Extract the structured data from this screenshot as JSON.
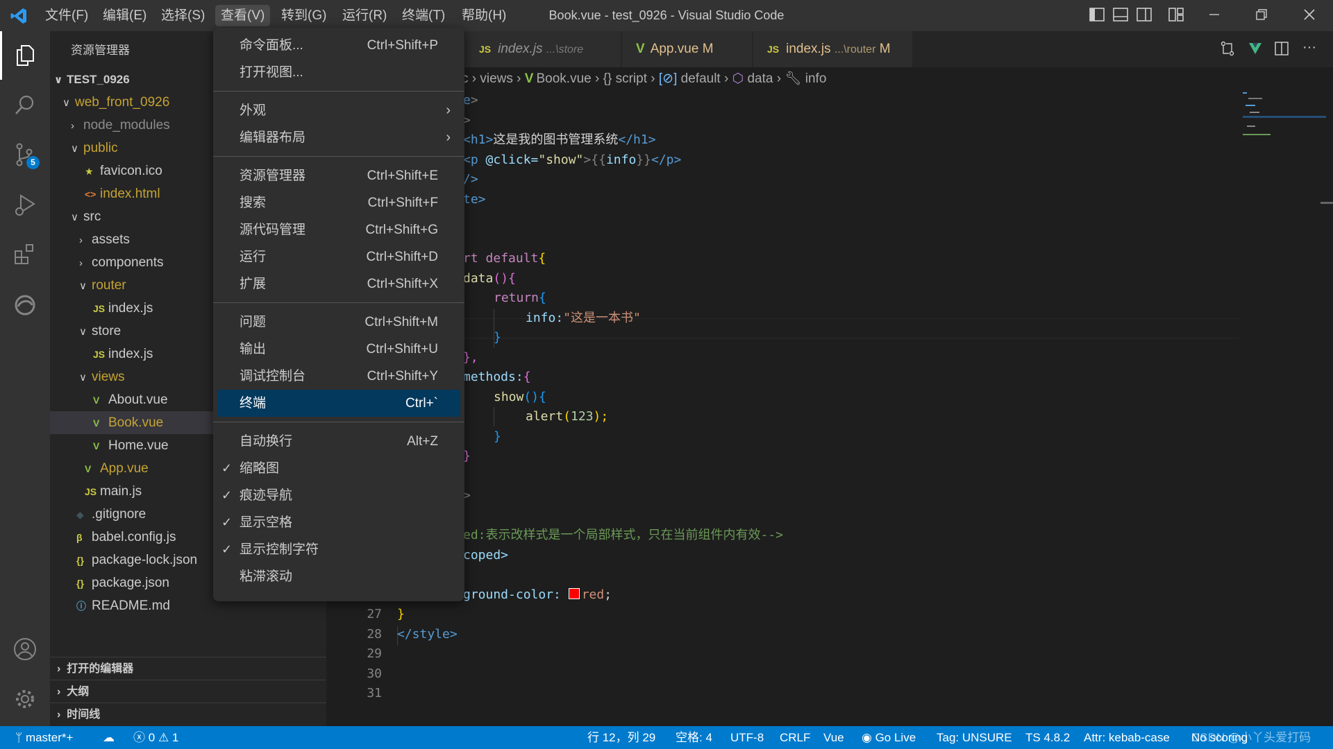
{
  "titlebar": {
    "menus": [
      "文件(F)",
      "编辑(E)",
      "选择(S)",
      "查看(V)",
      "转到(G)",
      "运行(R)",
      "终端(T)",
      "帮助(H)"
    ],
    "title": "Book.vue - test_0926 - Visual Studio Code"
  },
  "activity": {
    "scm_badge": "5"
  },
  "sidebar": {
    "header": "资源管理器",
    "root": "TEST_0926",
    "items": [
      {
        "label": "web_front_0926"
      },
      {
        "label": "node_modules"
      },
      {
        "label": "public"
      },
      {
        "label": "favicon.ico"
      },
      {
        "label": "index.html"
      },
      {
        "label": "src"
      },
      {
        "label": "assets"
      },
      {
        "label": "components"
      },
      {
        "label": "router"
      },
      {
        "label": "index.js"
      },
      {
        "label": "store"
      },
      {
        "label": "index.js"
      },
      {
        "label": "views"
      },
      {
        "label": "About.vue"
      },
      {
        "label": "Book.vue"
      },
      {
        "label": "Home.vue"
      },
      {
        "label": "App.vue"
      },
      {
        "label": "main.js"
      },
      {
        "label": ".gitignore"
      },
      {
        "label": "babel.config.js"
      },
      {
        "label": "package-lock.json"
      },
      {
        "label": "package.json"
      },
      {
        "label": "README.md"
      }
    ],
    "sections": [
      "打开的编辑器",
      "大纲",
      "时间线"
    ]
  },
  "tabs": [
    {
      "name": "index.js",
      "desc": "...\\store",
      "badge": ""
    },
    {
      "name": "App.vue",
      "desc": "",
      "badge": "M"
    },
    {
      "name": "index.js",
      "desc": "...\\router",
      "badge": "M"
    }
  ],
  "icons": {
    "js": "JS",
    "vue": "V"
  },
  "breadcrumb": [
    "c",
    "views",
    "Book.vue",
    "script",
    "default",
    "data",
    "info"
  ],
  "code": {
    "l1": "e",
    "l1b": ">",
    "l2": ">",
    "l3a": "<h1>",
    "l3b": "这是我的图书管理系统",
    "l3c": "</h1>",
    "l4a": "<p ",
    "l4b": "@click=",
    "l4c": "\"show\"",
    "l4d": ">",
    "l4e": "{{",
    "l4f": "info",
    "l4g": "}}",
    "l4h": "</p>",
    "l5": "/>",
    "l6": "te>",
    "l9a": "rt ",
    "l9b": "default",
    "l9c": "{",
    "l10a": "data",
    "l10b": "()",
    "l10c": "{",
    "l11a": "return",
    "l11b": "{",
    "l12a": "info:",
    "l12b": "\"这是一本书\"",
    "l13": "}",
    "l14": "},",
    "l15a": "methods:",
    "l15b": "{",
    "l16a": "show",
    "l16b": "()",
    "l16c": "{",
    "l17a": "alert",
    "l17b": "(",
    "l17c": "123",
    "l17d": ");",
    "l18": "}",
    "l19": "}",
    "l21": ">",
    "l23": "ed:表示改样式是一个局部样式，只在当前组件内有效-->",
    "l24": "coped>",
    "l26a": "ground-color: ",
    "l26b": "red",
    "l26c": ";",
    "l27": "}",
    "l28": "</style>"
  },
  "line_numbers": [
    "27",
    "28",
    "29",
    "30",
    "31"
  ],
  "view_menu": {
    "groups": [
      [
        {
          "label": "命令面板...",
          "shortcut": "Ctrl+Shift+P"
        },
        {
          "label": "打开视图...",
          "shortcut": ""
        }
      ],
      [
        {
          "label": "外观",
          "submenu": true
        },
        {
          "label": "编辑器布局",
          "submenu": true
        }
      ],
      [
        {
          "label": "资源管理器",
          "shortcut": "Ctrl+Shift+E"
        },
        {
          "label": "搜索",
          "shortcut": "Ctrl+Shift+F"
        },
        {
          "label": "源代码管理",
          "shortcut": "Ctrl+Shift+G"
        },
        {
          "label": "运行",
          "shortcut": "Ctrl+Shift+D"
        },
        {
          "label": "扩展",
          "shortcut": "Ctrl+Shift+X"
        }
      ],
      [
        {
          "label": "问题",
          "shortcut": "Ctrl+Shift+M"
        },
        {
          "label": "输出",
          "shortcut": "Ctrl+Shift+U"
        },
        {
          "label": "调试控制台",
          "shortcut": "Ctrl+Shift+Y"
        },
        {
          "label": "终端",
          "shortcut": "Ctrl+`",
          "highlighted": true
        }
      ],
      [
        {
          "label": "自动换行",
          "shortcut": "Alt+Z"
        },
        {
          "label": "缩略图",
          "checked": true
        },
        {
          "label": "痕迹导航",
          "checked": true
        },
        {
          "label": "显示空格",
          "checked": true
        },
        {
          "label": "显示控制字符",
          "checked": true
        },
        {
          "label": "粘滞滚动"
        }
      ]
    ],
    "check_glyph": "✓"
  },
  "status": {
    "branch": "master*+",
    "errors": "0",
    "warnings": "1",
    "right": [
      "行 12，列 29",
      "空格: 4",
      "UTF-8",
      "CRLF",
      "Vue",
      "Go Live",
      "Tag: UNSURE",
      "TS 4.8.2",
      "Attr: kebab-case",
      "No scoring"
    ],
    "watermark": "CSDN @小丫头爱打码"
  },
  "colors": {
    "accent": "#007acc",
    "menu_highlight": "#04395e",
    "git_modified": "#c5a332",
    "swatch_red": "#ff0000"
  }
}
